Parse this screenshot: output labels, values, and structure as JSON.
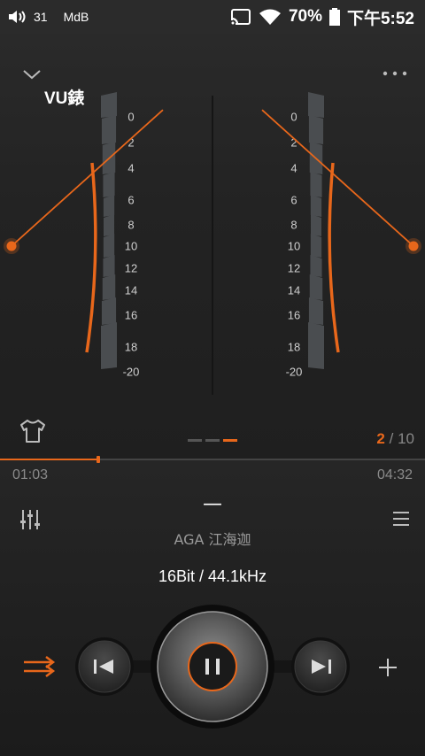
{
  "status_bar": {
    "notification_count": "31",
    "app_label": "MdB",
    "battery_percent": "70%",
    "time": "下午5:52"
  },
  "header": {
    "title": "VU錶"
  },
  "vu_meter": {
    "scale_labels": [
      "0",
      "2",
      "4",
      "6",
      "8",
      "10",
      "12",
      "14",
      "16",
      "18",
      "-20"
    ],
    "accent_color": "#e8671b",
    "left_needle_db": 1.5,
    "right_needle_db": 1.5
  },
  "pager": {
    "current": "2",
    "separator": "/",
    "total": "10",
    "active_dot_index": 2
  },
  "playback": {
    "elapsed": "01:03",
    "total": "04:32",
    "progress_fraction": 0.232
  },
  "track": {
    "title": "—",
    "artist": "AGA 江海迦",
    "format": "16Bit / 44.1kHz"
  },
  "controls": {
    "shuffle_icon": "shuffle-icon",
    "previous_icon": "previous-icon",
    "pause_icon": "pause-icon",
    "next_icon": "next-icon",
    "add_icon": "plus-icon"
  }
}
